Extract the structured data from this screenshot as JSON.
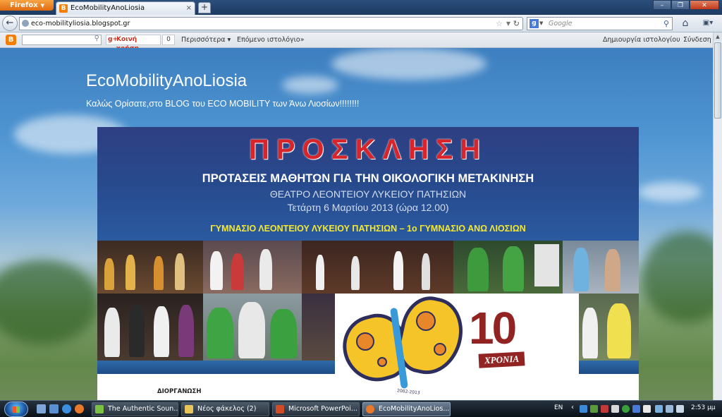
{
  "browser": {
    "app_button": "Firefox",
    "tab_title": "EcoMobilityAnoLiosia",
    "new_tab": "+",
    "url": "eco-mobilityliosia.blogspot.gr",
    "search_placeholder": "Google"
  },
  "blogger_nav": {
    "share_label": "Κοινή χρήση",
    "share_count": "0",
    "more_label": "Περισσότερα ▾",
    "next_blog_label": "Επόμενο ιστολόγιο»",
    "create_blog_label": "Δημιουργία ιστολογίου",
    "signin_label": "Σύνδεση"
  },
  "blog": {
    "title": "EcoMobilityAnoLiosia",
    "description": "Καλώς Ορίσατε,στο BLOG του ECO MOBILITY των Άνω Λιοσίων!!!!!!!!"
  },
  "poster": {
    "heading": "ΠΡΟΣΚΛΗΣΗ",
    "subtitle": "ΠΡΟΤΑΣΕΙΣ ΜΑΘΗΤΩΝ ΓΙΑ ΤΗΝ ΟΙΚΟΛΟΓΙΚΗ ΜΕΤΑΚΙΝΗΣΗ",
    "venue": "ΘΕΑΤΡΟ ΛΕΟΝΤΕΙΟΥ ΛΥΚΕΙΟΥ ΠΑΤΗΣΙΩΝ",
    "date": "Τετάρτη 6 Μαρτίου 2013 (ώρα 12.00)",
    "schools": "ΓΥΜΝΑΣΙΟ ΛΕΟΝΤΕΙΟΥ ΛΥΚΕΙΟΥ ΠΑΤΗΣΙΩΝ – 1ο  ΓΥΜΝΑΣΙΟ ΑΝΩ ΛΙΟΣΙΩΝ",
    "anniversary_number": "10",
    "anniversary_label": "ΧΡΟΝΙΑ",
    "logo_years": "2002-2013",
    "organizer_label": "ΔΙΟΡΓΑΝΩΣΗ"
  },
  "taskbar": {
    "tasks": [
      {
        "label": "The Authentic Soun..."
      },
      {
        "label": "Νέος φάκελος (2)"
      },
      {
        "label": "Microsoft PowerPoi..."
      },
      {
        "label": "EcoMobilityAnoLios..."
      }
    ],
    "language": "EN",
    "clock": "2:53 μμ"
  },
  "colors": {
    "poster_red": "#d8252c",
    "poster_blue": "#274a8d",
    "poster_yellow": "#f4e733",
    "firefox_orange": "#e06a10",
    "blogger_orange": "#f57d00"
  }
}
